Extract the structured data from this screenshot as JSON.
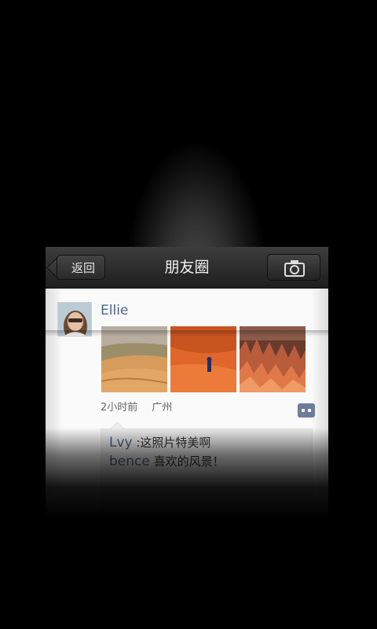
{
  "header": {
    "back_label": "返回",
    "title": "朋友圈",
    "camera_icon": "camera-icon"
  },
  "post": {
    "username": "Ellie",
    "time": "2小时前",
    "location": "广州",
    "photos": [
      "desert-dunes",
      "red-desert-walker",
      "red-rock-hoodoos"
    ],
    "comment_icon": "comment-bubble-icon"
  },
  "comments": [
    {
      "author": "Lvy",
      "text": ":这照片特美啊"
    },
    {
      "author": "bence",
      "text": "喜欢的风景！"
    }
  ],
  "colors": {
    "link": "#4a6490",
    "bar": "#2b2b2b",
    "background": "#000000"
  }
}
